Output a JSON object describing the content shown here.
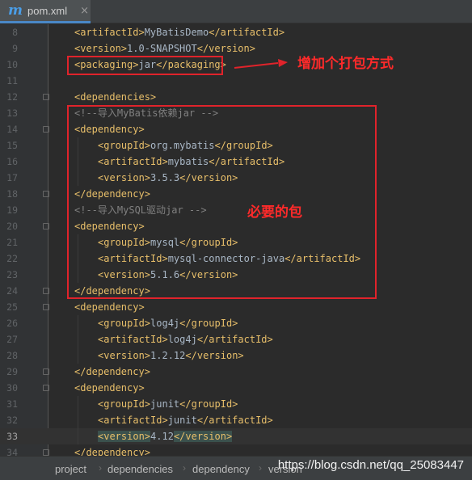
{
  "tab": {
    "icon": "m",
    "label": "pom.xml",
    "close": "×"
  },
  "lines": [
    {
      "n": "8",
      "code": [
        {
          "k": "tag",
          "t": "<artifactId>"
        },
        {
          "k": "txt",
          "t": "MyBatisDemo"
        },
        {
          "k": "tag",
          "t": "</artifactId>"
        }
      ]
    },
    {
      "n": "9",
      "code": [
        {
          "k": "tag",
          "t": "<version>"
        },
        {
          "k": "txt",
          "t": "1.0-SNAPSHOT"
        },
        {
          "k": "tag",
          "t": "</version>"
        }
      ]
    },
    {
      "n": "10",
      "code": [
        {
          "k": "tag",
          "t": "<packaging>"
        },
        {
          "k": "txt",
          "t": "jar"
        },
        {
          "k": "tag",
          "t": "</packaging>"
        }
      ]
    },
    {
      "n": "11",
      "code": []
    },
    {
      "n": "12",
      "code": [
        {
          "k": "tag",
          "t": "<dependencies>"
        }
      ]
    },
    {
      "n": "13",
      "code": [
        {
          "k": "comment",
          "t": "<!--导入MyBatis依赖jar -->"
        }
      ]
    },
    {
      "n": "14",
      "code": [
        {
          "k": "tag",
          "t": "<dependency>"
        }
      ]
    },
    {
      "n": "15",
      "code": [
        {
          "k": "tag",
          "t": "<groupId>"
        },
        {
          "k": "txt",
          "t": "org.mybatis"
        },
        {
          "k": "tag",
          "t": "</groupId>"
        }
      ]
    },
    {
      "n": "16",
      "code": [
        {
          "k": "tag",
          "t": "<artifactId>"
        },
        {
          "k": "txt",
          "t": "mybatis"
        },
        {
          "k": "tag",
          "t": "</artifactId>"
        }
      ]
    },
    {
      "n": "17",
      "code": [
        {
          "k": "tag",
          "t": "<version>"
        },
        {
          "k": "txt",
          "t": "3.5.3"
        },
        {
          "k": "tag",
          "t": "</version>"
        }
      ]
    },
    {
      "n": "18",
      "code": [
        {
          "k": "tag",
          "t": "</dependency>"
        }
      ]
    },
    {
      "n": "19",
      "code": [
        {
          "k": "comment",
          "t": "<!--导入MySQL驱动jar -->"
        }
      ]
    },
    {
      "n": "20",
      "code": [
        {
          "k": "tag",
          "t": "<dependency>"
        }
      ]
    },
    {
      "n": "21",
      "code": [
        {
          "k": "tag",
          "t": "<groupId>"
        },
        {
          "k": "txt",
          "t": "mysql"
        },
        {
          "k": "tag",
          "t": "</groupId>"
        }
      ]
    },
    {
      "n": "22",
      "code": [
        {
          "k": "tag",
          "t": "<artifactId>"
        },
        {
          "k": "txt",
          "t": "mysql-connector-java"
        },
        {
          "k": "tag",
          "t": "</artifactId>"
        }
      ]
    },
    {
      "n": "23",
      "code": [
        {
          "k": "tag",
          "t": "<version>"
        },
        {
          "k": "txt",
          "t": "5.1.6"
        },
        {
          "k": "tag",
          "t": "</version>"
        }
      ]
    },
    {
      "n": "24",
      "code": [
        {
          "k": "tag",
          "t": "</dependency>"
        }
      ]
    },
    {
      "n": "25",
      "code": [
        {
          "k": "tag",
          "t": "<dependency>"
        }
      ]
    },
    {
      "n": "26",
      "code": [
        {
          "k": "tag",
          "t": "<groupId>"
        },
        {
          "k": "txt",
          "t": "log4j"
        },
        {
          "k": "tag",
          "t": "</groupId>"
        }
      ]
    },
    {
      "n": "27",
      "code": [
        {
          "k": "tag",
          "t": "<artifactId>"
        },
        {
          "k": "txt",
          "t": "log4j"
        },
        {
          "k": "tag",
          "t": "</artifactId>"
        }
      ]
    },
    {
      "n": "28",
      "code": [
        {
          "k": "tag",
          "t": "<version>"
        },
        {
          "k": "txt",
          "t": "1.2.12"
        },
        {
          "k": "tag",
          "t": "</version>"
        }
      ]
    },
    {
      "n": "29",
      "code": [
        {
          "k": "tag",
          "t": "</dependency>"
        }
      ]
    },
    {
      "n": "30",
      "code": [
        {
          "k": "tag",
          "t": "<dependency>"
        }
      ]
    },
    {
      "n": "31",
      "code": [
        {
          "k": "tag",
          "t": "<groupId>"
        },
        {
          "k": "txt",
          "t": "junit"
        },
        {
          "k": "tag",
          "t": "</groupId>"
        }
      ]
    },
    {
      "n": "32",
      "code": [
        {
          "k": "tag",
          "t": "<artifactId>"
        },
        {
          "k": "txt",
          "t": "junit"
        },
        {
          "k": "tag",
          "t": "</artifactId>"
        }
      ]
    },
    {
      "n": "33",
      "code": [
        {
          "k": "tag",
          "t": "<version>"
        },
        {
          "k": "txt",
          "t": "4.12"
        },
        {
          "k": "tag",
          "t": "</version>"
        }
      ],
      "current": true
    },
    {
      "n": "34",
      "code": [
        {
          "k": "tag",
          "t": "</dependency>"
        }
      ]
    }
  ],
  "annotations": {
    "packaging_note": "增加个打包方式",
    "deps_note": "必要的包"
  },
  "breadcrumb": [
    "project",
    "dependencies",
    "dependency",
    "version"
  ],
  "watermark": "https://blog.csdn.net/qq_25083447",
  "colors": {
    "editor_bg": "#2b2b2b",
    "tag": "#e8bf6a",
    "text": "#a9b7c6",
    "comment": "#808080",
    "annotation_red": "#e0232b"
  }
}
